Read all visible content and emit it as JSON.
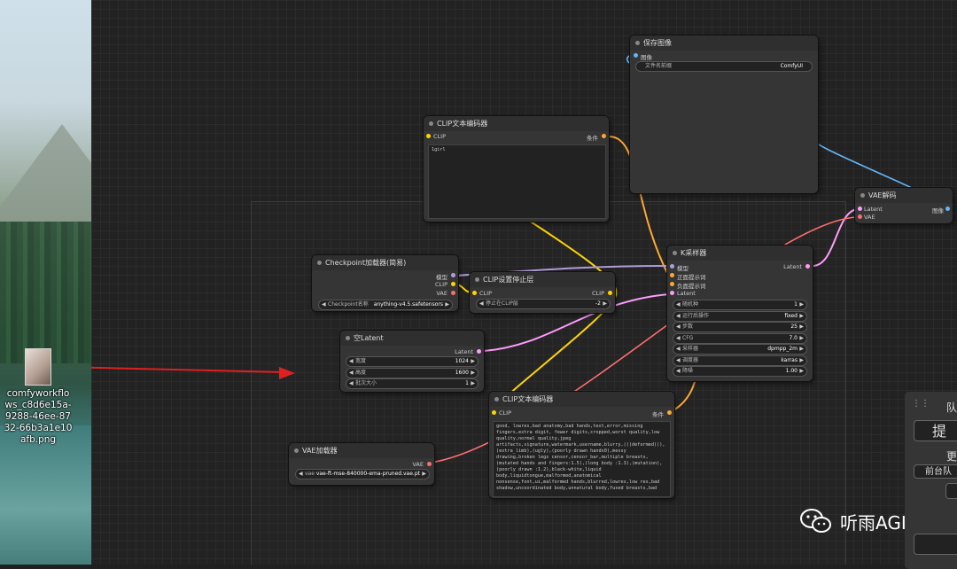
{
  "desktop": {
    "file_name": "comfyworkflows_c8d6e15a-9288-46ee-8732-66b3a1e10afb.png"
  },
  "nodes": {
    "save_image": {
      "title": "保存图像",
      "input_image": "图像",
      "filename_prefix_label": "文件名前缀",
      "filename_prefix_value": "ComfyUI"
    },
    "clip_text_pos": {
      "title": "CLIP文本编码器",
      "input_clip": "CLIP",
      "output_cond": "条件",
      "text": "1girl"
    },
    "vae_decode": {
      "title": "VAE解码",
      "input_latent": "Latent",
      "input_vae": "VAE",
      "output_image": "图像"
    },
    "ksampler": {
      "title": "K采样器",
      "in_model": "模型",
      "in_pos": "正面提示词",
      "in_neg": "负面提示词",
      "in_latent": "Latent",
      "out_latent": "Latent",
      "widgets": [
        {
          "label": "随机种",
          "value": "1"
        },
        {
          "label": "运行后操作",
          "value": "fixed"
        },
        {
          "label": "步数",
          "value": "25"
        },
        {
          "label": "CFG",
          "value": "7.0"
        },
        {
          "label": "采样器",
          "value": "dpmpp_2m"
        },
        {
          "label": "调度器",
          "value": "karras"
        },
        {
          "label": "降噪",
          "value": "1.00"
        }
      ]
    },
    "checkpoint": {
      "title": "Checkpoint加载器(简易)",
      "out_model": "模型",
      "out_clip": "CLIP",
      "out_vae": "VAE",
      "ckpt_label": "Checkpoint名称",
      "ckpt_value": "anything-v4.5.safetensors"
    },
    "clip_skip": {
      "title": "CLIP设置停止层",
      "in_clip": "CLIP",
      "out_clip": "CLIP",
      "layer_label": "停止在CLIP层",
      "layer_value": "-2"
    },
    "empty_latent": {
      "title": "空Latent",
      "out_latent": "Latent",
      "widgets": [
        {
          "label": "宽度",
          "value": "1024"
        },
        {
          "label": "高度",
          "value": "1600"
        },
        {
          "label": "批次大小",
          "value": "1"
        }
      ]
    },
    "clip_text_neg": {
      "title": "CLIP文本编码器",
      "input_clip": "CLIP",
      "output_cond": "条件",
      "text": "good, lowres,bad anatomy,bad hands,text,error,missing fingers,extra digit, fewer digits,cropped,worst quality,low quality,normal quality,jpeg artifacts,signature,watermark,username,blurry,(((deformed))),(extra_limb),(ugly),(poorly drawn hands0),messy drawing,broken legs censor,censor_bar,multiple breasts,(mutated hands and fingers:1.5),(long body :1.3),(mutation),(poorly drawn :1.2),black-white,liquid body,liquidtongue,malformed,anatomical nonsense,font,ui,malformed hands,blurred,lowres,low res,bad shadow,uncoordinated body,unnatural body,fused breasts,bad"
    },
    "vae_loader": {
      "title": "VAE加载器",
      "out_vae": "VAE",
      "vae_label": "vae",
      "vae_value": "vae-ft-mse-840000-ema-pruned.vae.pt"
    }
  },
  "queue_panel": {
    "header": "队",
    "queue_button": "提",
    "more_label": "更",
    "bg_queue": "前台队"
  },
  "watermark": {
    "text": "听雨AGI"
  },
  "colors": {
    "clip": "#ffd500",
    "conditioning": "#ffa931",
    "model": "#b39ddb",
    "latent": "#ff9cf9",
    "vae": "#ff6e6e",
    "image": "#64b5f6",
    "arrow": "#e02020"
  }
}
